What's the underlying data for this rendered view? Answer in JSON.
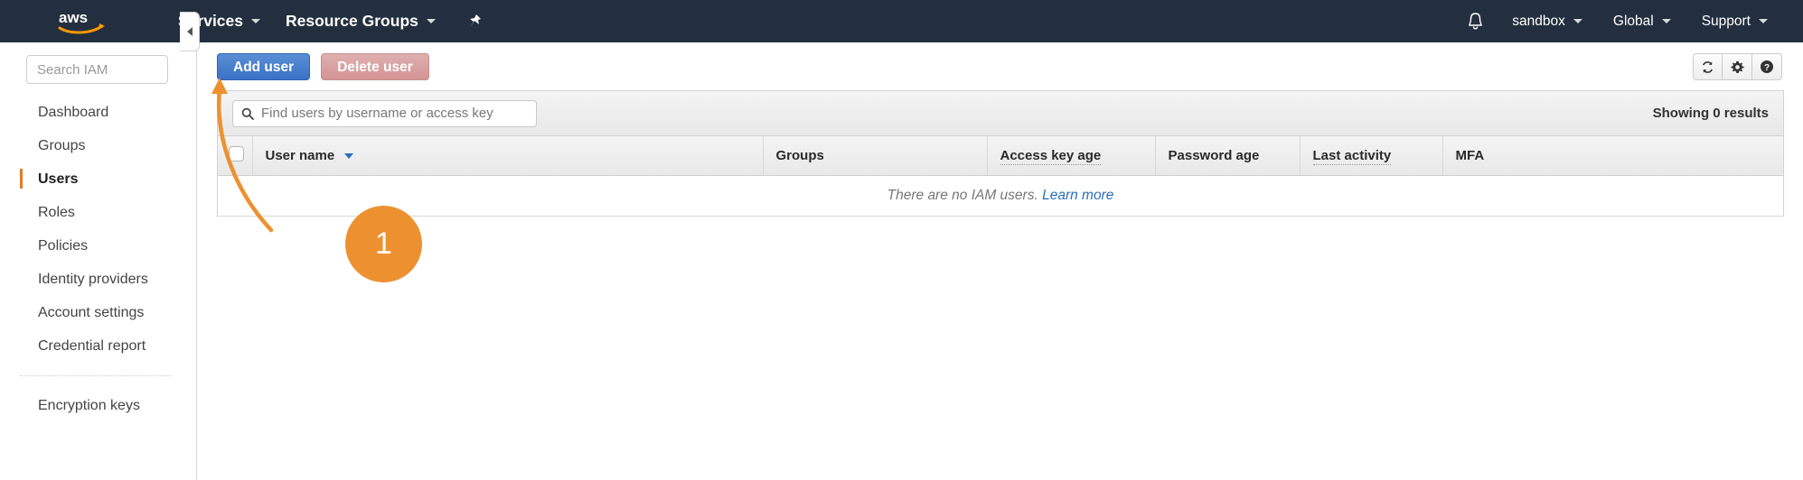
{
  "topnav": {
    "logo_alt": "aws",
    "services_label": "Services",
    "resource_groups_label": "Resource Groups",
    "pin_icon": "pin-icon",
    "bell_icon": "bell-icon",
    "account_label": "sandbox",
    "region_label": "Global",
    "support_label": "Support",
    "background_color": "#232f3e"
  },
  "sidebar": {
    "search_placeholder": "Search IAM",
    "search_value": "",
    "items": [
      {
        "label": "Dashboard",
        "active": false
      },
      {
        "label": "Groups",
        "active": false
      },
      {
        "label": "Users",
        "active": true
      },
      {
        "label": "Roles",
        "active": false
      },
      {
        "label": "Policies",
        "active": false
      },
      {
        "label": "Identity providers",
        "active": false
      },
      {
        "label": "Account settings",
        "active": false
      },
      {
        "label": "Credential report",
        "active": false
      }
    ],
    "footer_items": [
      {
        "label": "Encryption keys",
        "active": false
      }
    ],
    "active_marker_color": "#e07b28",
    "collapse_icon": "chevron-left-icon"
  },
  "toolbar": {
    "add_user_label": "Add user",
    "delete_user_label": "Delete user",
    "add_user_color": "#3a72c6",
    "delete_user_color": "#d49494",
    "icons": [
      {
        "name": "refresh-icon"
      },
      {
        "name": "gear-icon"
      },
      {
        "name": "help-icon"
      }
    ]
  },
  "panel": {
    "find_placeholder": "Find users by username or access key",
    "find_value": "",
    "search_icon": "search-icon",
    "results_text": "Showing 0 results"
  },
  "table": {
    "columns": [
      {
        "label": "User name",
        "sorted": true,
        "dotted": false
      },
      {
        "label": "Groups",
        "sorted": false,
        "dotted": false
      },
      {
        "label": "Access key age",
        "sorted": false,
        "dotted": true
      },
      {
        "label": "Password age",
        "sorted": false,
        "dotted": false
      },
      {
        "label": "Last activity",
        "sorted": false,
        "dotted": true
      },
      {
        "label": "MFA",
        "sorted": false,
        "dotted": false
      }
    ],
    "select_all_checked": false,
    "empty_message": "There are no IAM users.",
    "empty_link_label": "Learn more",
    "rows": []
  },
  "annotation": {
    "step_number": "1",
    "color": "#ed9130",
    "points_to": "add-user-button"
  }
}
